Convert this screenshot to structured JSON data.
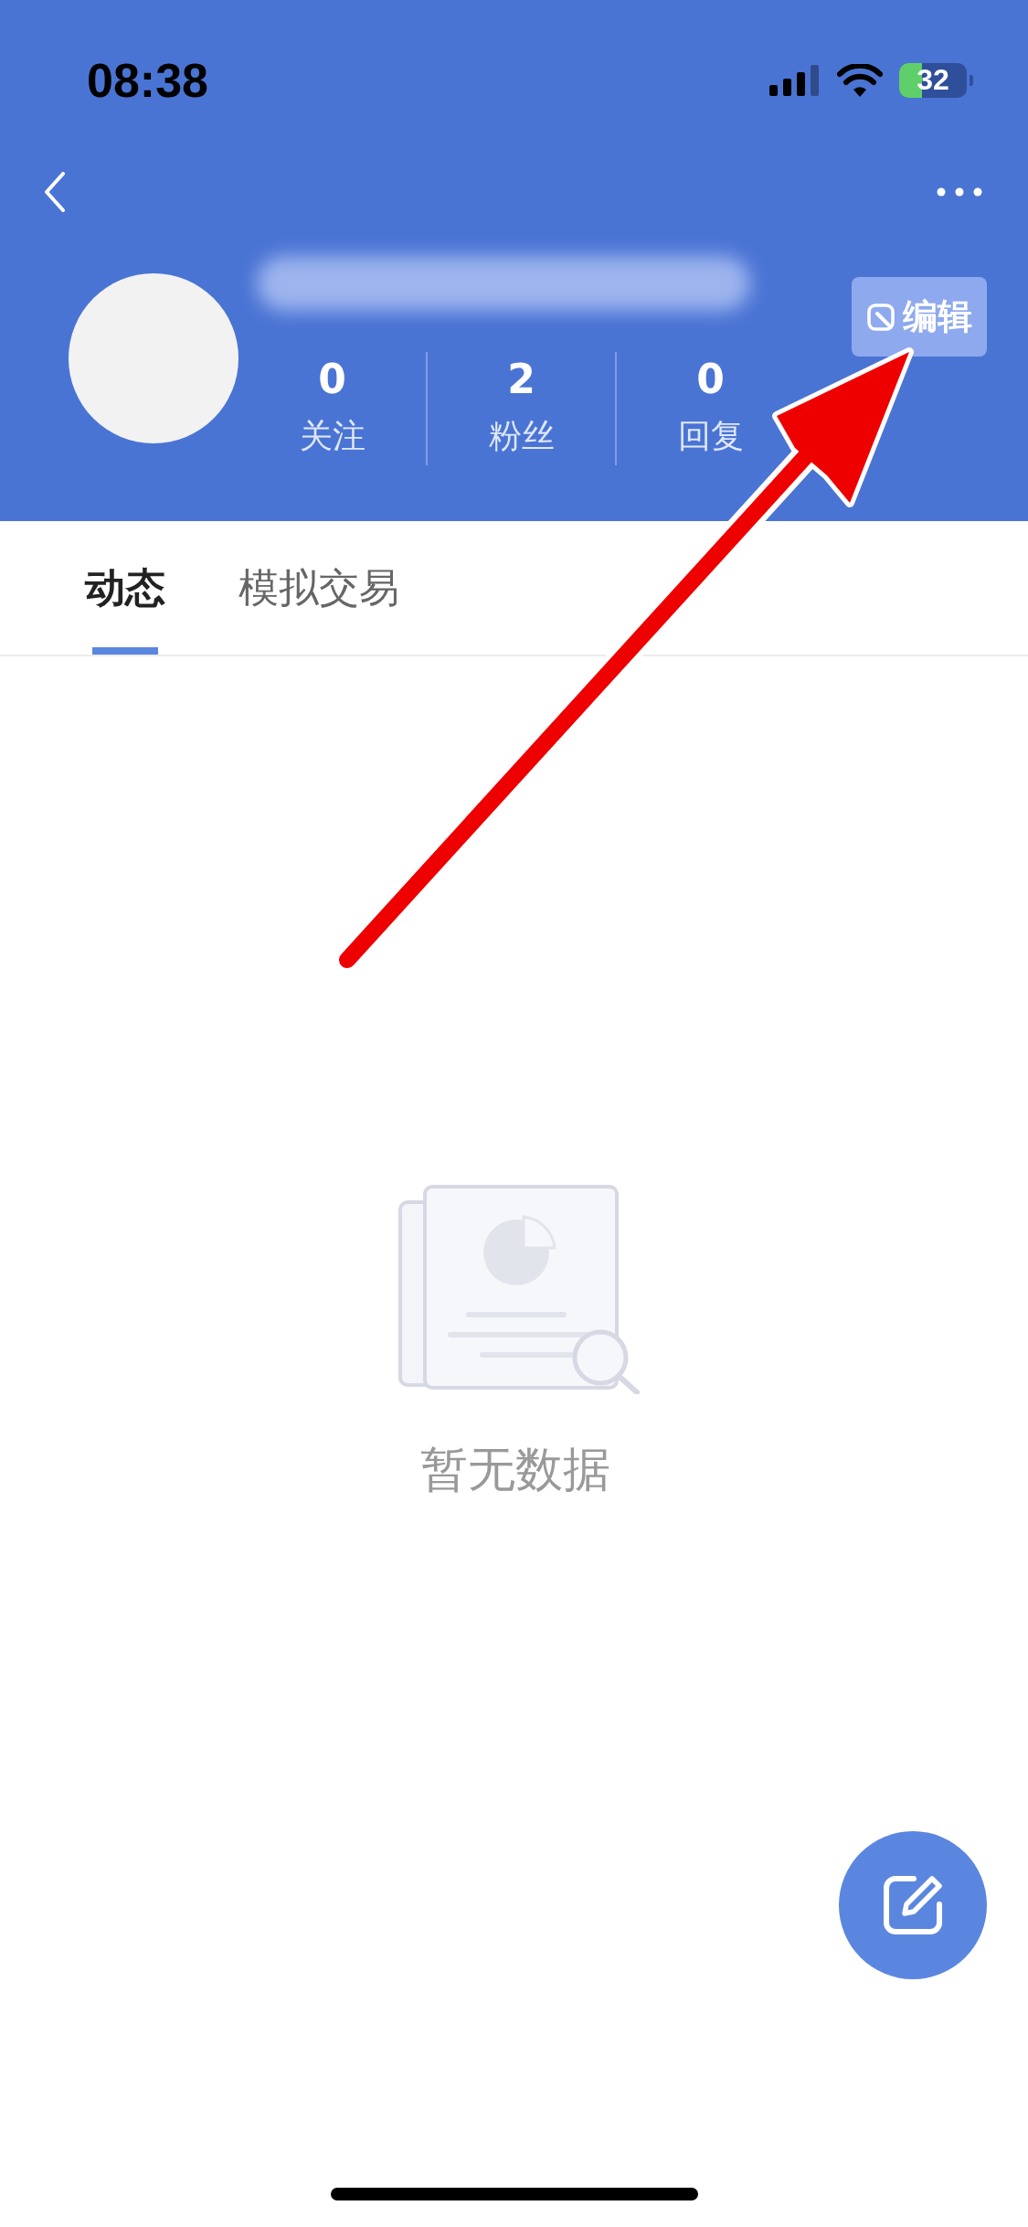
{
  "status_bar": {
    "time": "08:38",
    "battery": "32"
  },
  "header": {
    "edit_button": "编辑",
    "stats": [
      {
        "value": "0",
        "label": "关注"
      },
      {
        "value": "2",
        "label": "粉丝"
      },
      {
        "value": "0",
        "label": "回复"
      }
    ]
  },
  "tabs": [
    {
      "label": "动态",
      "selected": true
    },
    {
      "label": "模拟交易",
      "selected": false
    }
  ],
  "empty_state": {
    "message": "暂无数据"
  }
}
